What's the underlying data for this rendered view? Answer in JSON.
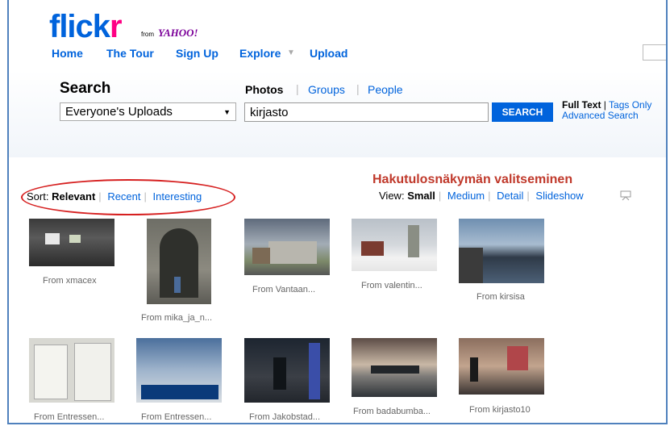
{
  "logo": {
    "part1": "flick",
    "part2": "r",
    "from": "from",
    "yahoo": "YAHOO!"
  },
  "nav": {
    "home": "Home",
    "tour": "The Tour",
    "signup": "Sign Up",
    "explore": "Explore",
    "upload": "Upload"
  },
  "search": {
    "heading": "Search",
    "scope": "Everyone's Uploads",
    "tabs": [
      "Photos",
      "Groups",
      "People"
    ],
    "query": "kirjasto",
    "button": "SEARCH",
    "full_text": "Full Text",
    "tags_only": "Tags Only",
    "advanced": "Advanced Search"
  },
  "sort": {
    "label": "Sort:",
    "relevant": "Relevant",
    "recent": "Recent",
    "interesting": "Interesting"
  },
  "annotation": "Hakutulosnäkymän valitseminen",
  "view": {
    "label": "View:",
    "small": "Small",
    "medium": "Medium",
    "detail": "Detail",
    "slideshow": "Slideshow"
  },
  "results": [
    "From xmacex",
    "From mika_ja_n...",
    "From Vantaan...",
    "From valentin...",
    "From kirsisa",
    "From Entressen...",
    "From Entressen...",
    "From Jakobstad...",
    "From badabumba...",
    "From kirjasto10"
  ],
  "colors": {
    "brand_blue": "#0063dc",
    "brand_pink": "#ff0084",
    "annotation_red": "#d62020"
  }
}
